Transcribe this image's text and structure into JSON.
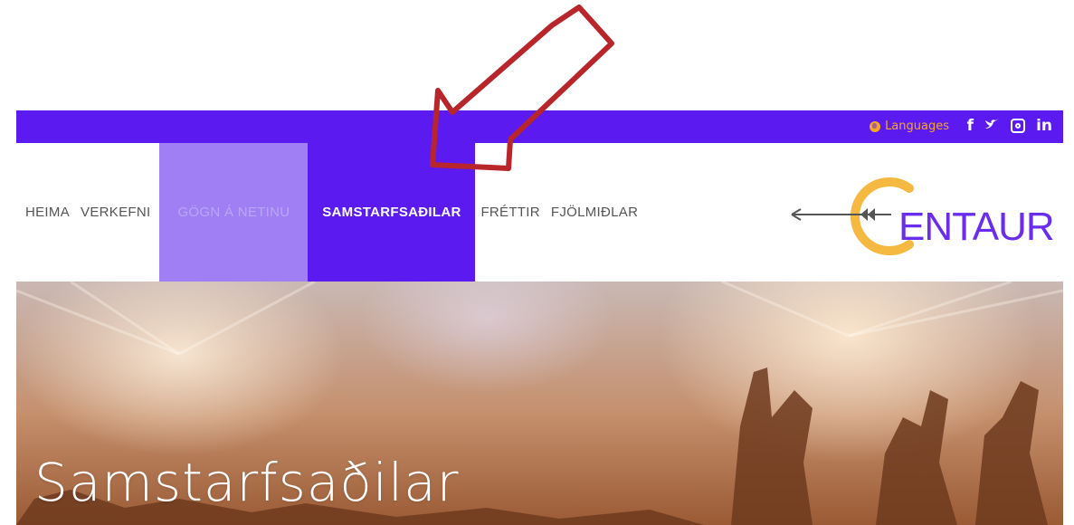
{
  "topbar": {
    "languages_label": "Languages",
    "social": {
      "facebook": "f",
      "twitter": "❯",
      "linkedin": "in"
    }
  },
  "nav": {
    "items": [
      {
        "label": "HEIMA"
      },
      {
        "label": "VERKEFNI"
      },
      {
        "label": "GÖGN Á NETINU"
      },
      {
        "label": "SAMSTARFSAÐILAR"
      },
      {
        "label": "FRÉTTIR"
      },
      {
        "label": "FJÖLMIÐLAR"
      }
    ]
  },
  "logo": {
    "text": "ENTAUR"
  },
  "hero": {
    "title": "Samstarfsaðilar"
  },
  "colors": {
    "brand_purple": "#5b1bf0",
    "hover_purple": "#a07ff5",
    "accent_orange": "#f5a623",
    "arrow_red": "#b8252a"
  }
}
